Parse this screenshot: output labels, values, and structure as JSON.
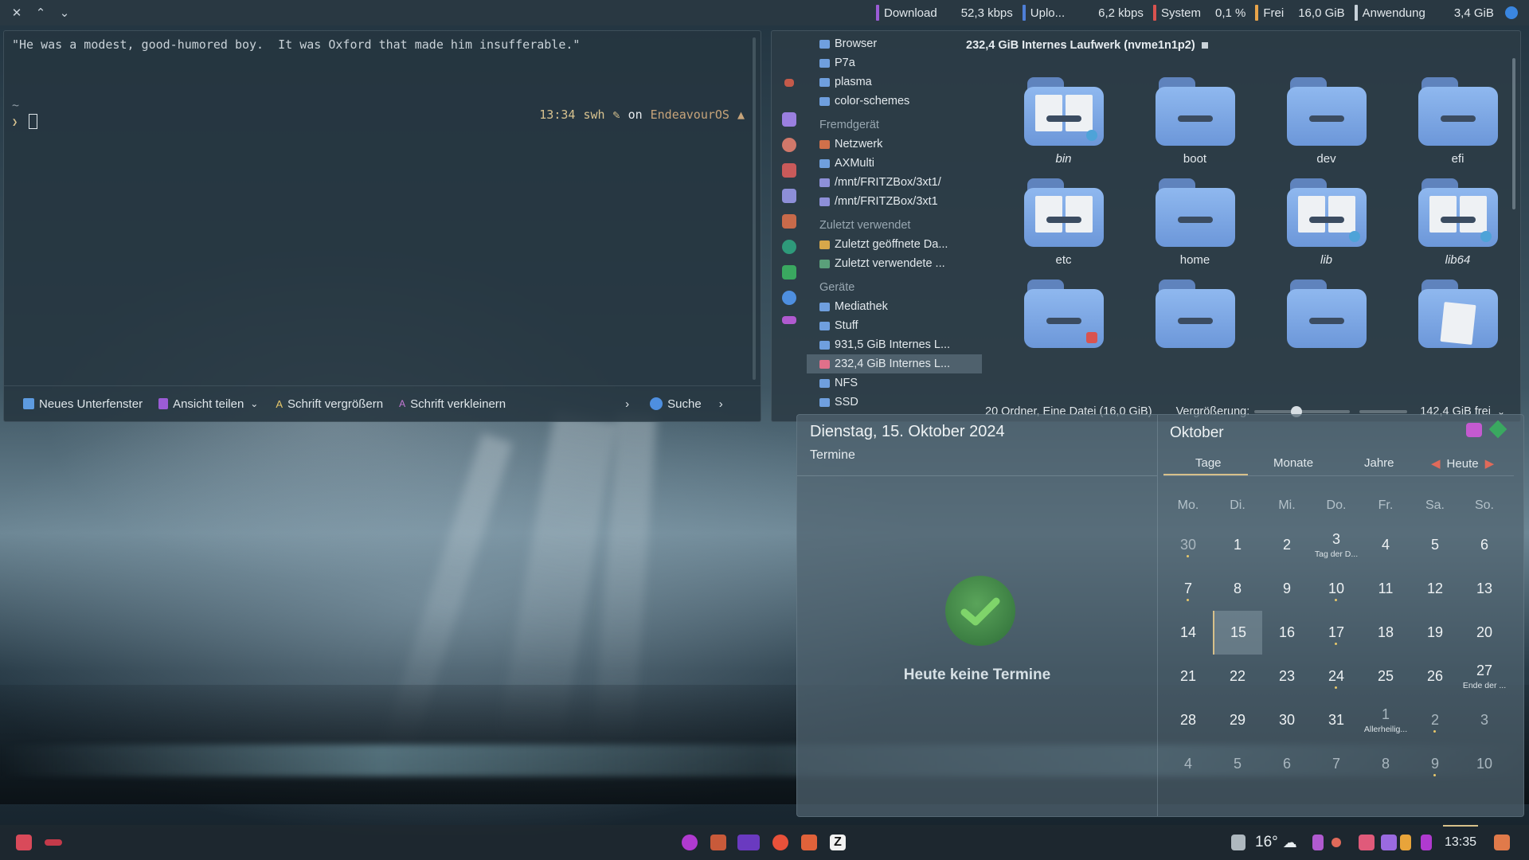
{
  "top_panel": {
    "window_controls": [
      "close-icon",
      "chevron-up-icon",
      "chevron-down-icon"
    ],
    "download_label": "Download",
    "download_value": "52,3 kbps",
    "upload_label": "Uplo...",
    "upload_value": "6,2 kbps",
    "system_label": "System",
    "system_value": "0,1 %",
    "free_label": "Frei",
    "free_value": "16,0 GiB",
    "app_label": "Anwendung",
    "app_value": "3,4 GiB"
  },
  "terminal": {
    "quote": "\"He was a modest, good-humored boy.  It was Oxford that made him insufferable.\"",
    "tilde": "~",
    "prompt_time": "13:34",
    "prompt_user": "swh",
    "prompt_on": "on",
    "prompt_os": "EndeavourOS",
    "prompt_symbol": "❯",
    "toolbar": {
      "new_tab": "Neues Unterfenster",
      "split_view": "Ansicht teilen",
      "font_bigger": "Schrift vergrößern",
      "font_smaller": "Schrift verkleinern",
      "search": "Suche"
    }
  },
  "file_manager": {
    "sidebar": {
      "top_items": [
        "Browser",
        "P7a",
        "plasma",
        "color-schemes"
      ],
      "remote_heading": "Fremdgerät",
      "remote_items": [
        "Netzwerk",
        "AXMulti",
        "/mnt/FRITZBox/3xt1/",
        "/mnt/FRITZBox/3xt1"
      ],
      "recent_heading": "Zuletzt verwendet",
      "recent_items": [
        "Zuletzt geöffnete Da...",
        "Zuletzt verwendete ..."
      ],
      "devices_heading": "Geräte",
      "device_items": [
        "Mediathek",
        "Stuff",
        "931,5 GiB Internes L...",
        "232,4 GiB Internes L...",
        "NFS",
        "SSD"
      ]
    },
    "location": "232,4 GiB Internes Laufwerk (nvme1n1p2)",
    "items": [
      {
        "name": "bin",
        "style": "symlink"
      },
      {
        "name": "boot",
        "style": "plain"
      },
      {
        "name": "dev",
        "style": "plain"
      },
      {
        "name": "efi",
        "style": "plain"
      },
      {
        "name": "etc",
        "style": "docs"
      },
      {
        "name": "home",
        "style": "plain"
      },
      {
        "name": "lib",
        "style": "symlink"
      },
      {
        "name": "lib64",
        "style": "symlink"
      },
      {
        "name": "",
        "style": "locked"
      },
      {
        "name": "",
        "style": "plain"
      },
      {
        "name": "",
        "style": "plain"
      },
      {
        "name": "",
        "style": "file"
      }
    ],
    "status": "20 Ordner, Eine Datei (16,0 GiB)",
    "zoom_label": "Vergrößerung:",
    "free_space": "142,4 GiB frei"
  },
  "calendar": {
    "date_heading": "Dienstag, 15. Oktober 2024",
    "events_heading": "Termine",
    "no_events": "Heute keine Termine",
    "month": "Oktober",
    "tabs": [
      "Tage",
      "Monate",
      "Jahre"
    ],
    "today_button": "Heute",
    "weekdays": [
      "Mo.",
      "Di.",
      "Mi.",
      "Do.",
      "Fr.",
      "Sa.",
      "So."
    ],
    "weeks": [
      [
        {
          "d": "30",
          "dim": true,
          "dot": true
        },
        {
          "d": "1"
        },
        {
          "d": "2"
        },
        {
          "d": "3",
          "ev": "Tag der D..."
        },
        {
          "d": "4"
        },
        {
          "d": "5"
        },
        {
          "d": "6"
        }
      ],
      [
        {
          "d": "7",
          "dot": true
        },
        {
          "d": "8"
        },
        {
          "d": "9"
        },
        {
          "d": "10",
          "dot": true
        },
        {
          "d": "11"
        },
        {
          "d": "12"
        },
        {
          "d": "13"
        }
      ],
      [
        {
          "d": "14"
        },
        {
          "d": "15",
          "today": true
        },
        {
          "d": "16"
        },
        {
          "d": "17",
          "dot": true
        },
        {
          "d": "18"
        },
        {
          "d": "19"
        },
        {
          "d": "20"
        }
      ],
      [
        {
          "d": "21"
        },
        {
          "d": "22"
        },
        {
          "d": "23"
        },
        {
          "d": "24",
          "dot": true
        },
        {
          "d": "25"
        },
        {
          "d": "26"
        },
        {
          "d": "27",
          "ev": "Ende der ..."
        }
      ],
      [
        {
          "d": "28"
        },
        {
          "d": "29"
        },
        {
          "d": "30"
        },
        {
          "d": "31"
        },
        {
          "d": "1",
          "dim": true,
          "ev": "Allerheilig..."
        },
        {
          "d": "2",
          "dim": true,
          "dot": true
        },
        {
          "d": "3",
          "dim": true
        }
      ],
      [
        {
          "d": "4",
          "dim": true
        },
        {
          "d": "5",
          "dim": true
        },
        {
          "d": "6",
          "dim": true
        },
        {
          "d": "7",
          "dim": true
        },
        {
          "d": "8",
          "dim": true
        },
        {
          "d": "9",
          "dim": true,
          "dot": true
        },
        {
          "d": "10",
          "dim": true
        }
      ]
    ]
  },
  "taskbar": {
    "temperature": "16°",
    "clock": "13:35"
  },
  "colors": {
    "accent_gold": "#d7c08a",
    "folder_blue": "#7aa5e4",
    "download_bar": "#9b5cd6",
    "upload_bar": "#4e7fd8",
    "system_bar": "#d9534f",
    "free_bar": "#e8a44a",
    "app_bar": "#c8d2da"
  }
}
